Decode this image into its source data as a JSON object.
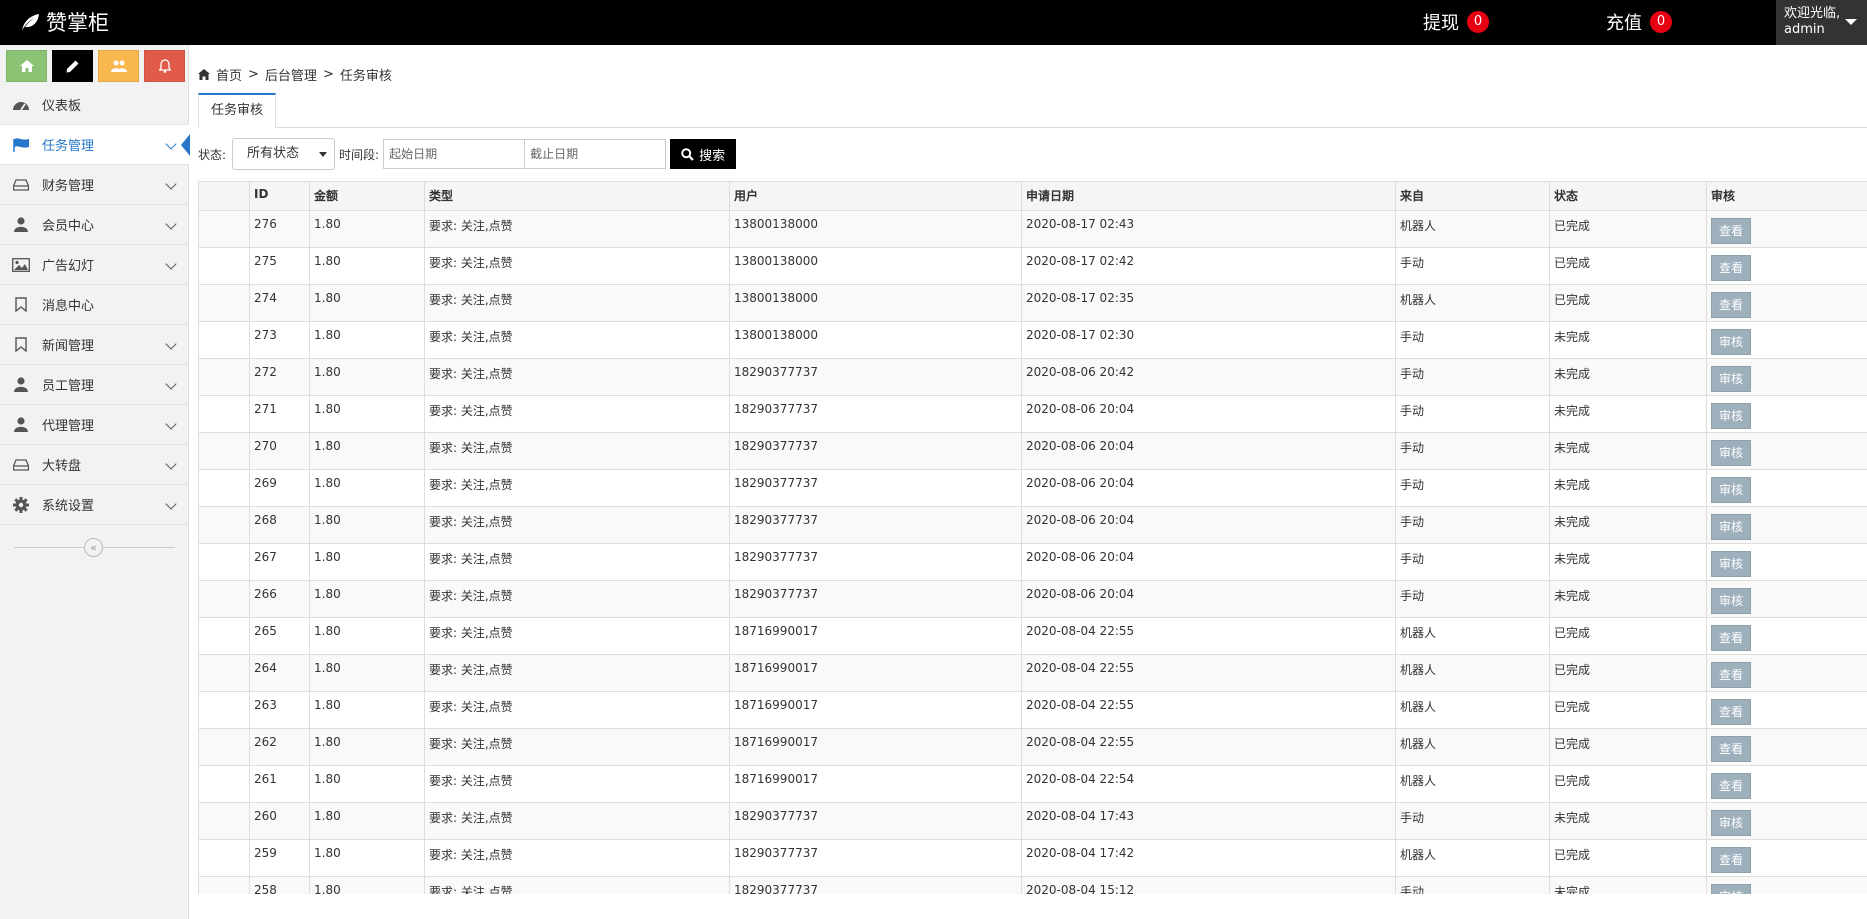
{
  "app": {
    "brand": "赞掌柜"
  },
  "header": {
    "withdraw": {
      "label": "提现",
      "count": "0"
    },
    "recharge": {
      "label": "充值",
      "count": "0"
    },
    "user": {
      "greeting": "欢迎光临,",
      "name": "admin"
    }
  },
  "shortcuts": [
    {
      "icon": "home-icon",
      "color": "#8cc274"
    },
    {
      "icon": "pencil-icon",
      "color": "#000000"
    },
    {
      "icon": "users-icon",
      "color": "#f8b84e"
    },
    {
      "icon": "bell-icon",
      "color": "#e05b49"
    }
  ],
  "sidebar": {
    "items": [
      {
        "label": "仪表板",
        "icon": "dashboard-icon",
        "expandable": false,
        "active": false
      },
      {
        "label": "任务管理",
        "icon": "flag-icon",
        "expandable": true,
        "active": true
      },
      {
        "label": "财务管理",
        "icon": "drive-icon",
        "expandable": true,
        "active": false
      },
      {
        "label": "会员中心",
        "icon": "user-icon",
        "expandable": true,
        "active": false
      },
      {
        "label": "广告幻灯",
        "icon": "picture-icon",
        "expandable": true,
        "active": false
      },
      {
        "label": "消息中心",
        "icon": "bookmark-icon",
        "expandable": false,
        "active": false
      },
      {
        "label": "新闻管理",
        "icon": "bookmark-icon",
        "expandable": true,
        "active": false
      },
      {
        "label": "员工管理",
        "icon": "user-icon",
        "expandable": true,
        "active": false
      },
      {
        "label": "代理管理",
        "icon": "user-icon",
        "expandable": true,
        "active": false
      },
      {
        "label": "大转盘",
        "icon": "drive-icon",
        "expandable": true,
        "active": false
      },
      {
        "label": "系统设置",
        "icon": "gear-icon",
        "expandable": true,
        "active": false
      }
    ],
    "collapse_symbol": "«"
  },
  "breadcrumb": {
    "home": "首页",
    "level1": "后台管理",
    "level2": "任务审核",
    "sep": ">"
  },
  "tab": {
    "label": "任务审核"
  },
  "filters": {
    "status_label": "状态:",
    "status_value": "所有状态",
    "period_label": "时间段:",
    "start_placeholder": "起始日期",
    "end_placeholder": "截止日期",
    "search_label": "搜索"
  },
  "table": {
    "columns": [
      "",
      "ID",
      "金额",
      "类型",
      "用户",
      "申请日期",
      "来自",
      "状态",
      "审核"
    ],
    "rows": [
      [
        "276",
        "1.80",
        "要求: 关注,点赞",
        "13800138000",
        "2020-08-17 02:43",
        "机器人",
        "已完成",
        "查看"
      ],
      [
        "275",
        "1.80",
        "要求: 关注,点赞",
        "13800138000",
        "2020-08-17 02:42",
        "手动",
        "已完成",
        "查看"
      ],
      [
        "274",
        "1.80",
        "要求: 关注,点赞",
        "13800138000",
        "2020-08-17 02:35",
        "机器人",
        "已完成",
        "查看"
      ],
      [
        "273",
        "1.80",
        "要求: 关注,点赞",
        "13800138000",
        "2020-08-17 02:30",
        "手动",
        "未完成",
        "审核"
      ],
      [
        "272",
        "1.80",
        "要求: 关注,点赞",
        "18290377737",
        "2020-08-06 20:42",
        "手动",
        "未完成",
        "审核"
      ],
      [
        "271",
        "1.80",
        "要求: 关注,点赞",
        "18290377737",
        "2020-08-06 20:04",
        "手动",
        "未完成",
        "审核"
      ],
      [
        "270",
        "1.80",
        "要求: 关注,点赞",
        "18290377737",
        "2020-08-06 20:04",
        "手动",
        "未完成",
        "审核"
      ],
      [
        "269",
        "1.80",
        "要求: 关注,点赞",
        "18290377737",
        "2020-08-06 20:04",
        "手动",
        "未完成",
        "审核"
      ],
      [
        "268",
        "1.80",
        "要求: 关注,点赞",
        "18290377737",
        "2020-08-06 20:04",
        "手动",
        "未完成",
        "审核"
      ],
      [
        "267",
        "1.80",
        "要求: 关注,点赞",
        "18290377737",
        "2020-08-06 20:04",
        "手动",
        "未完成",
        "审核"
      ],
      [
        "266",
        "1.80",
        "要求: 关注,点赞",
        "18290377737",
        "2020-08-06 20:04",
        "手动",
        "未完成",
        "审核"
      ],
      [
        "265",
        "1.80",
        "要求: 关注,点赞",
        "18716990017",
        "2020-08-04 22:55",
        "机器人",
        "已完成",
        "查看"
      ],
      [
        "264",
        "1.80",
        "要求: 关注,点赞",
        "18716990017",
        "2020-08-04 22:55",
        "机器人",
        "已完成",
        "查看"
      ],
      [
        "263",
        "1.80",
        "要求: 关注,点赞",
        "18716990017",
        "2020-08-04 22:55",
        "机器人",
        "已完成",
        "查看"
      ],
      [
        "262",
        "1.80",
        "要求: 关注,点赞",
        "18716990017",
        "2020-08-04 22:55",
        "机器人",
        "已完成",
        "查看"
      ],
      [
        "261",
        "1.80",
        "要求: 关注,点赞",
        "18716990017",
        "2020-08-04 22:54",
        "机器人",
        "已完成",
        "查看"
      ],
      [
        "260",
        "1.80",
        "要求: 关注,点赞",
        "18290377737",
        "2020-08-04 17:43",
        "手动",
        "未完成",
        "审核"
      ],
      [
        "259",
        "1.80",
        "要求: 关注,点赞",
        "18290377737",
        "2020-08-04 17:42",
        "机器人",
        "已完成",
        "查看"
      ],
      [
        "258",
        "1.80",
        "要求: 关注,点赞",
        "18290377737",
        "2020-08-04 15:12",
        "手动",
        "未完成",
        "审核"
      ]
    ]
  }
}
